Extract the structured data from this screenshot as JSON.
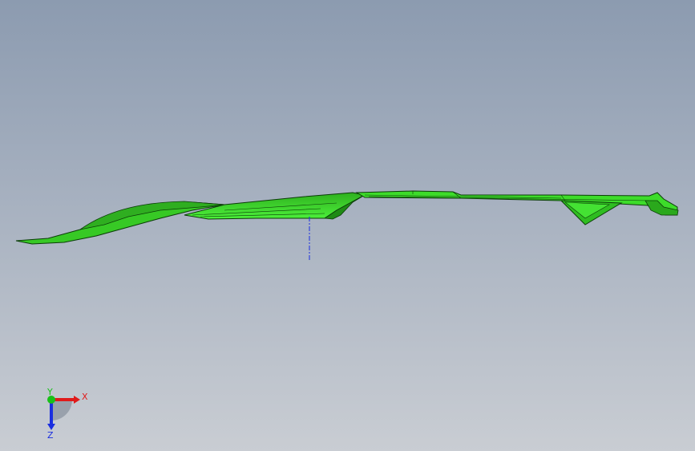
{
  "viewport": {
    "background_top": "#8c9bb0",
    "background_bottom": "#c9cdd3"
  },
  "model": {
    "name": "green-sheet-part",
    "face_color": "#3ddc2a",
    "edge_color": "#0b3d08"
  },
  "triad": {
    "x_label": "X",
    "y_label": "Y",
    "z_label": "Z",
    "x_color": "#e01a1a",
    "y_color": "#18c018",
    "z_color": "#1a2ee0"
  }
}
